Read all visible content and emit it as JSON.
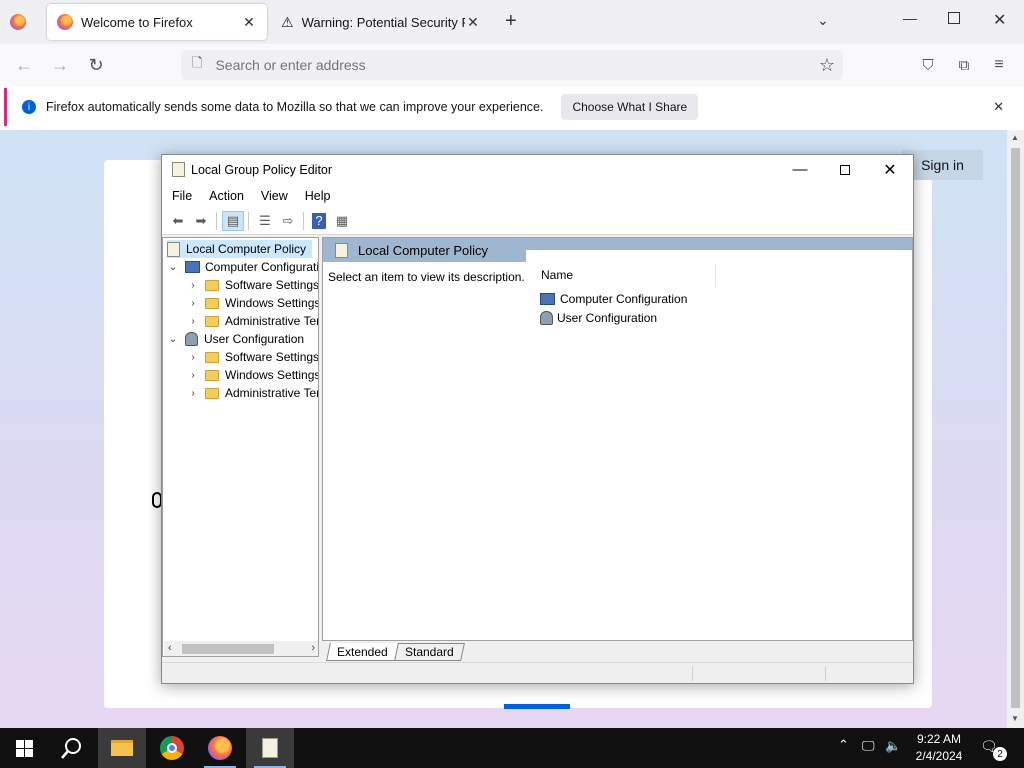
{
  "browser": {
    "tabs": [
      {
        "label": "Welcome to Firefox",
        "icon": "firefox-icon",
        "active": true
      },
      {
        "label": "Warning: Potential Security Risk Ahead",
        "icon": "warning-icon",
        "active": false
      }
    ],
    "address_placeholder": "Search or enter address",
    "infobar": {
      "message": "Firefox automatically sends some data to Mozilla so that we can improve your experience.",
      "button": "Choose What I Share"
    },
    "page": {
      "sign_in": "Sign in"
    }
  },
  "mmc": {
    "title": "Local Group Policy Editor",
    "menu": [
      "File",
      "Action",
      "View",
      "Help"
    ],
    "tree": [
      {
        "label": "Local Computer Policy",
        "level": 0,
        "icon": "policy-icon",
        "selected": true
      },
      {
        "label": "Computer Configuration",
        "level": 1,
        "icon": "computer-icon",
        "expanded": true
      },
      {
        "label": "Software Settings",
        "level": 2,
        "icon": "folder-icon"
      },
      {
        "label": "Windows Settings",
        "level": 2,
        "icon": "folder-icon"
      },
      {
        "label": "Administrative Templates",
        "level": 2,
        "icon": "folder-icon"
      },
      {
        "label": "User Configuration",
        "level": 1,
        "icon": "user-icon",
        "expanded": true
      },
      {
        "label": "Software Settings",
        "level": 2,
        "icon": "folder-icon"
      },
      {
        "label": "Windows Settings",
        "level": 2,
        "icon": "folder-icon"
      },
      {
        "label": "Administrative Templates",
        "level": 2,
        "icon": "folder-icon"
      }
    ],
    "right_header": "Local Computer Policy",
    "description": "Select an item to view its description.",
    "column_name": "Name",
    "items": [
      {
        "label": "Computer Configuration",
        "icon": "computer-icon"
      },
      {
        "label": "User Configuration",
        "icon": "user-icon"
      }
    ],
    "view_tabs": [
      "Extended",
      "Standard"
    ]
  },
  "taskbar": {
    "time": "9:22 AM",
    "date": "2/4/2024",
    "notifications": "2"
  }
}
